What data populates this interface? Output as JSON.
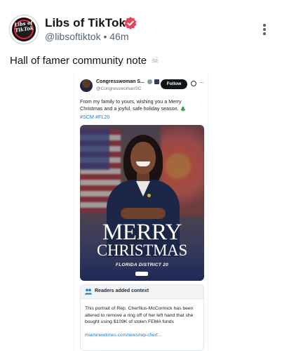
{
  "post": {
    "author_name": "Libs of TikTok",
    "avatar_text": "Libs of TikTok",
    "handle": "@libsoftiktok",
    "separator": "•",
    "time": "46m",
    "text": "Hall of famer community note",
    "emoji_icon": "skull-crossbones-icon",
    "verified_color": "#e8455c"
  },
  "embedded": {
    "name": "Congresswoman S...",
    "handle": "@CongresswomanSC",
    "follow_label": "Follow",
    "more_label": "···",
    "text": "From my family to yours, wishing you a Merry Christmas and a joyful, safe holiday season.",
    "tree_icon": "🎄",
    "hashtags": "#SCM #FL20",
    "image": {
      "title_line1": "MERRY",
      "title_line2": "CHRISTMAS",
      "subtitle": "FLORIDA DISTRICT 20"
    },
    "note": {
      "title": "Readers added context",
      "body": "This portrait of Rep. Cherfilus-McCormick has been altered to remove a ring off of her left hand that she bought using $109K of stolen FEMA funds",
      "link": "miaminewtimes.com/news/rep-cherf..."
    }
  },
  "colors": {
    "link_blue": "#1d7ac6",
    "text_dark": "#0f1419",
    "text_muted": "#536471"
  }
}
